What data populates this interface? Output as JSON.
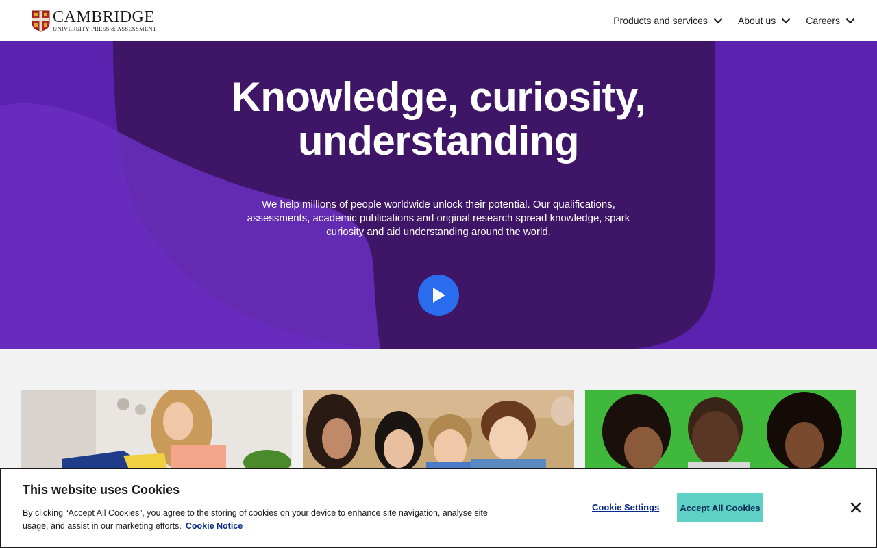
{
  "header": {
    "logo_main": "CAMBRIDGE",
    "logo_sub": "UNIVERSITY PRESS & ASSESSMENT",
    "nav": [
      {
        "label": "Products and services",
        "icon": "chevron-down-icon"
      },
      {
        "label": "About us",
        "icon": "chevron-down-icon"
      },
      {
        "label": "Careers",
        "icon": "chevron-down-icon"
      }
    ]
  },
  "hero": {
    "title": "Knowledge, curiosity, understanding",
    "description": "We help millions of people worldwide unlock their potential. Our qualifications, assessments, academic publications and original research spread knowledge, spark curiosity and aid understanding around the world.",
    "play_icon": "play-icon"
  },
  "cards": [
    {
      "image": "woman reading a book"
    },
    {
      "image": "group of smiling students"
    },
    {
      "image": "children on green background"
    }
  ],
  "cookie": {
    "title": "This website uses Cookies",
    "text": "By clicking “Accept All Cookies”, you agree to the storing of cookies on your device to enhance site navigation, analyse site usage, and assist in our marketing efforts.",
    "notice_link": "Cookie Notice",
    "settings_label": "Cookie Settings",
    "accept_label": "Accept All Cookies",
    "close_icon": "close-icon"
  },
  "colors": {
    "hero_purple": "#5b22b0",
    "hero_dark": "#3f1568",
    "play_blue": "#2a6dee",
    "accept_teal": "#5ed0c4"
  }
}
